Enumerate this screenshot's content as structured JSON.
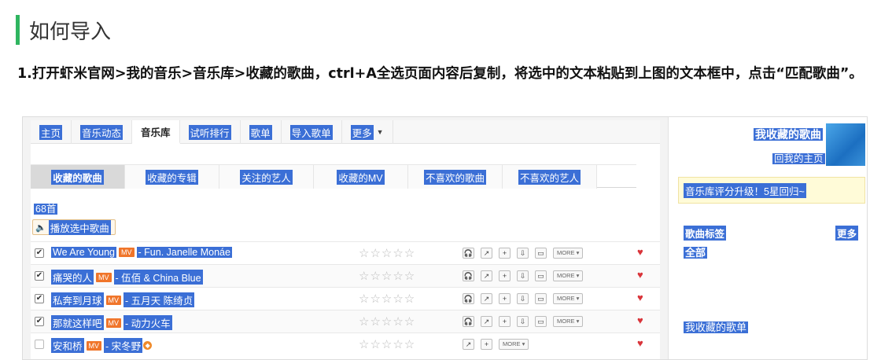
{
  "page": {
    "title": "如何导入",
    "instruction": "1.打开虾米官网>我的音乐>音乐库>收藏的歌曲，ctrl+A全选页面内容后复制，将选中的文本粘贴到上图的文本框中，点击“匹配歌曲”。"
  },
  "xiami": {
    "nav": [
      "主页",
      "音乐动态",
      "音乐库",
      "试听排行",
      "歌单",
      "导入歌单",
      "更多"
    ],
    "nav_active_index": 2,
    "subtabs": [
      "收藏的歌曲",
      "收藏的专辑",
      "关注的艺人",
      "收藏的MV",
      "不喜欢的歌曲",
      "不喜欢的艺人"
    ],
    "subtab_active_index": 0,
    "song_count": "68首",
    "play_selected": "播放选中歌曲",
    "mv_label": "MV",
    "more_label": "MORE",
    "songs": [
      {
        "name": "We Are Young",
        "artist": "- Fun. Janelle Monáe",
        "checked": true
      },
      {
        "name": "痛哭的人",
        "artist": "- 伍佰 & China Blue",
        "checked": true
      },
      {
        "name": "私奔到月球",
        "artist": "- 五月天 陈绮贞",
        "checked": true
      },
      {
        "name": "那就这样吧",
        "artist": "- 动力火车",
        "checked": true
      },
      {
        "name": "安和桥",
        "artist": "- 宋冬野",
        "checked": false
      }
    ],
    "sidebar": {
      "title": "我收藏的歌曲",
      "home_link": "回我的主页",
      "notice": "音乐库评分升级！5星回归~",
      "tags_heading": "歌曲标签",
      "tags_more": "更多",
      "tags_all": "全部",
      "playlists_heading": "我收藏的歌单"
    },
    "colors": {
      "accent": "#2fb560",
      "selection": "#3b6fd6",
      "mv": "#f0752a",
      "heart": "#d9343a"
    }
  }
}
